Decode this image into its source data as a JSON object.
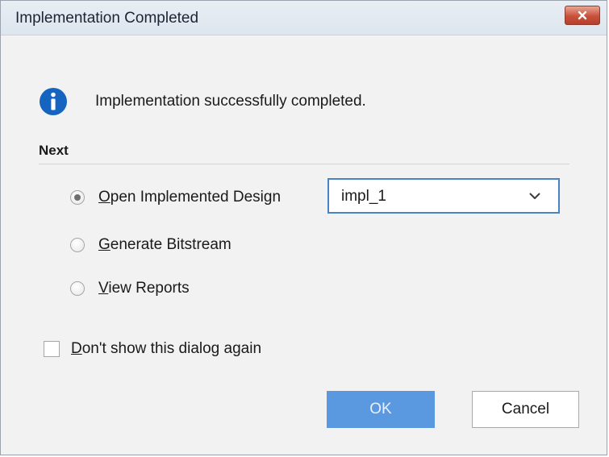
{
  "window": {
    "title": "Implementation Completed",
    "close_icon": "close-icon"
  },
  "message": {
    "icon": "info-icon",
    "text": "Implementation successfully completed."
  },
  "next": {
    "label": "Next",
    "options": [
      {
        "label": "Open Implemented Design",
        "mnemonic": "O",
        "rest": "pen Implemented Design",
        "selected": true
      },
      {
        "label": "Generate Bitstream",
        "mnemonic": "G",
        "rest": "enerate Bitstream",
        "selected": false
      },
      {
        "label": "View Reports",
        "mnemonic": "V",
        "rest": "iew Reports",
        "selected": false
      }
    ],
    "run_select": {
      "value": "impl_1",
      "icon": "chevron-down-icon"
    }
  },
  "dont_show": {
    "label": "Don't show this dialog again",
    "mnemonic": "D",
    "rest": "on't show this dialog again",
    "checked": false
  },
  "buttons": {
    "ok_label": "OK",
    "cancel_label": "Cancel"
  },
  "colors": {
    "accent": "#5a98df",
    "info_icon": "#1565c0",
    "close_button": "#c8513b"
  }
}
